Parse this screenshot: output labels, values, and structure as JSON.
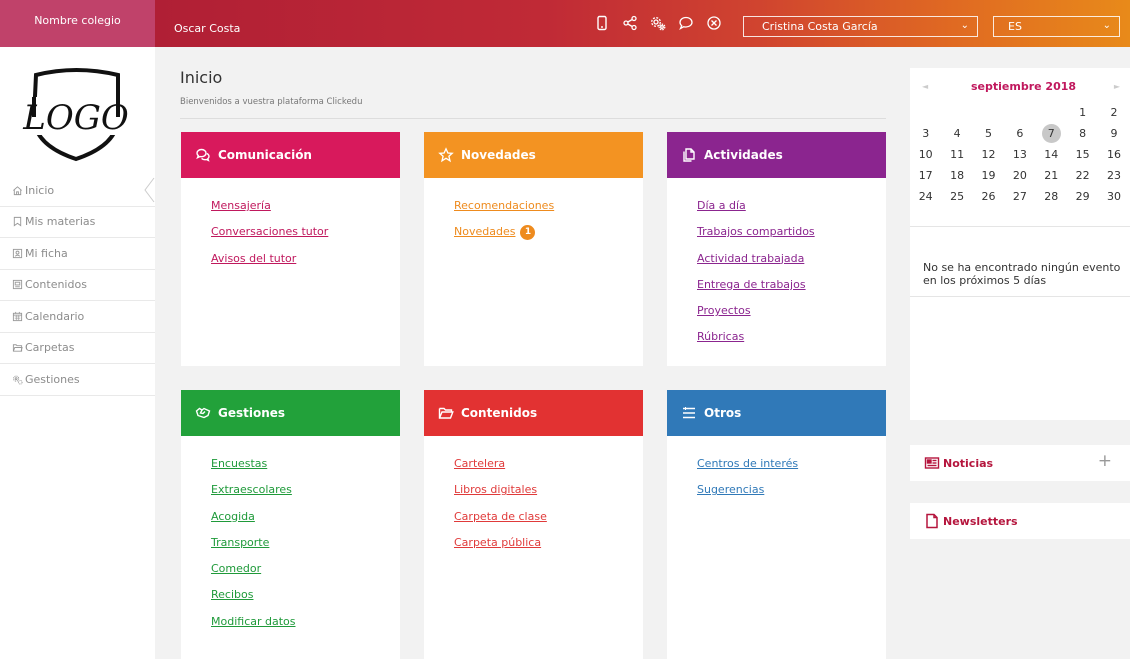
{
  "header": {
    "school_name": "Nombre colegio",
    "user_name": "Oscar Costa",
    "selected_student": "Cristina Costa García",
    "language": "ES",
    "icons": [
      "mobile-icon",
      "share-icon",
      "settings-icon",
      "chat-icon",
      "close-circle-icon"
    ]
  },
  "sidebar": {
    "logo_text": "LOGO",
    "items": [
      {
        "label": "Inicio",
        "icon": "home-icon"
      },
      {
        "label": "Mis materias",
        "icon": "bookmark-icon"
      },
      {
        "label": "Mi ficha",
        "icon": "profile-card-icon"
      },
      {
        "label": "Contenidos",
        "icon": "content-icon"
      },
      {
        "label": "Calendario",
        "icon": "calendar-icon"
      },
      {
        "label": "Carpetas",
        "icon": "folder-icon"
      },
      {
        "label": "Gestiones",
        "icon": "gears-icon"
      }
    ]
  },
  "main": {
    "title": "Inicio",
    "subtitle": "Bienvenidos a vuestra plataforma Clickedu",
    "cards": [
      {
        "title": "Comunicación",
        "color": "#d8195c",
        "link_color": "#c0185d",
        "icon": "chat-bubbles-icon",
        "links": [
          "Mensajería",
          "Conversaciones tutor",
          "Avisos del tutor"
        ]
      },
      {
        "title": "Novedades",
        "color": "#f39322",
        "link_color": "#ee8b1e",
        "icon": "star-icon",
        "links": [
          "Recomendaciones",
          "Novedades"
        ],
        "badge": "1"
      },
      {
        "title": "Actividades",
        "color": "#8b258f",
        "link_color": "#8b258f",
        "icon": "copy-icon",
        "links": [
          "Día a día",
          "Trabajos compartidos",
          "Actividad trabajada",
          "Entrega de trabajos",
          "Proyectos",
          "Rúbricas"
        ]
      },
      {
        "title": "Gestiones",
        "color": "#22a13a",
        "link_color": "#1f9a3a",
        "icon": "handshake-icon",
        "links": [
          "Encuestas",
          "Extraescolares",
          "Acogida",
          "Transporte",
          "Comedor",
          "Recibos",
          "Modificar datos"
        ]
      },
      {
        "title": "Contenidos",
        "color": "#e23232",
        "link_color": "#e03a3a",
        "icon": "folder-open-icon",
        "links": [
          "Cartelera",
          "Libros digitales",
          "Carpeta de clase",
          "Carpeta pública"
        ]
      },
      {
        "title": "Otros",
        "color": "#3079b8",
        "link_color": "#3079b8",
        "icon": "list-icon",
        "links": [
          "Centros de interés",
          "Sugerencias"
        ]
      }
    ]
  },
  "calendar": {
    "month_label": "septiembre 2018",
    "prev": "◄",
    "next": "►",
    "weeks": [
      [
        "",
        "",
        "",
        "",
        "",
        "1",
        "2"
      ],
      [
        "3",
        "4",
        "5",
        "6",
        "7",
        "8",
        "9"
      ],
      [
        "10",
        "11",
        "12",
        "13",
        "14",
        "15",
        "16"
      ],
      [
        "17",
        "18",
        "19",
        "20",
        "21",
        "22",
        "23"
      ],
      [
        "24",
        "25",
        "26",
        "27",
        "28",
        "29",
        "30"
      ]
    ],
    "today": "7",
    "no_events": "No se ha encontrado ningún evento en los próximos 5 días"
  },
  "right": {
    "news_label": "Noticias",
    "newsletters_label": "Newsletters",
    "accent": "#b5153d"
  }
}
